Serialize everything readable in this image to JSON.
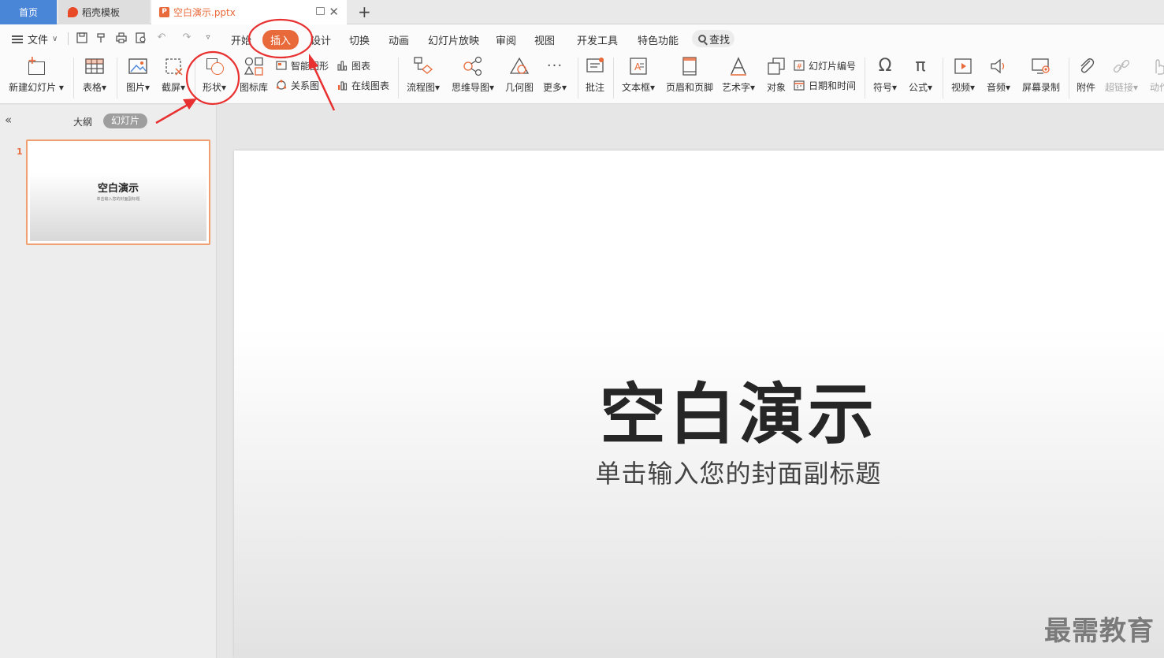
{
  "tabs": {
    "home": "首页",
    "templates": "稻壳模板",
    "document": "空白演示.pptx",
    "new_tab": "+"
  },
  "menu": {
    "file": "文件",
    "tabs": [
      "开始",
      "插入",
      "设计",
      "切换",
      "动画",
      "幻灯片放映",
      "审阅",
      "视图",
      "开发工具",
      "特色功能"
    ],
    "active_tab": "插入",
    "search": "查找"
  },
  "ribbon": {
    "new_slide": "新建幻灯片",
    "table": "表格",
    "picture": "图片",
    "screenshot": "截屏",
    "shape": "形状",
    "icon_library": "图标库",
    "smart_graphic": "智能图形",
    "relation_chart": "关系图",
    "chart": "图表",
    "online_chart": "在线图表",
    "flowchart": "流程图",
    "mindmap": "思维导图",
    "geometry": "几何图",
    "more": "更多",
    "comment": "批注",
    "textbox": "文本框",
    "header_footer": "页眉和页脚",
    "wordart": "艺术字",
    "object": "对象",
    "slide_number": "幻灯片编号",
    "date_time": "日期和时间",
    "symbol": "符号",
    "formula": "公式",
    "video": "视频",
    "audio": "音频",
    "screen_record": "屏幕录制",
    "attachment": "附件",
    "hyperlink": "超链接",
    "action": "动作"
  },
  "panel": {
    "outline": "大纲",
    "slides": "幻灯片",
    "slide_number": "1"
  },
  "slide": {
    "title": "空白演示",
    "subtitle": "单击输入您的封面副标题"
  },
  "watermark": "最需教育",
  "colors": {
    "accent": "#e8693a",
    "home_tab": "#4a86d8",
    "annotation": "#e83030"
  }
}
